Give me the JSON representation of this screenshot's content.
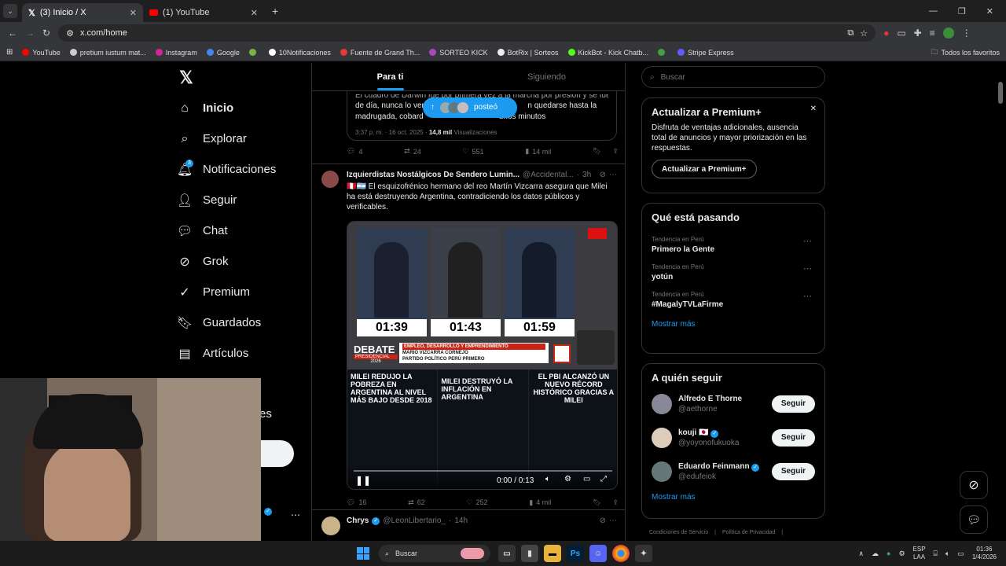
{
  "browser": {
    "tabs": [
      {
        "label": "(3) Inicio / X"
      },
      {
        "label": "(1) YouTube"
      }
    ],
    "url": "x.com/home",
    "bookmarks": [
      {
        "label": "YouTube",
        "color": "#ff0000"
      },
      {
        "label": "pretium iustum mat...",
        "color": "#cccccc"
      },
      {
        "label": "Instagram",
        "color": "#d6249f"
      },
      {
        "label": "Google",
        "color": "#4285f4"
      },
      {
        "label": "",
        "color": "#7cb342"
      },
      {
        "label": "10Notificaciones",
        "color": "#ffffff"
      },
      {
        "label": "Fuente de Grand Th...",
        "color": "#e53935"
      },
      {
        "label": "SORTEO KICK",
        "color": "#ab47bc"
      },
      {
        "label": "BotRix | Sorteos",
        "color": "#eeeeee"
      },
      {
        "label": "KickBot - Kick Chatb...",
        "color": "#53fc18"
      },
      {
        "label": "",
        "color": "#43a047"
      },
      {
        "label": "Stripe Express",
        "color": "#635bff"
      }
    ],
    "all_bookmarks": "Todos los favoritos"
  },
  "nav": {
    "items": [
      {
        "label": "Inicio",
        "icon": "home-icon"
      },
      {
        "label": "Explorar",
        "icon": "search-icon"
      },
      {
        "label": "Notificaciones",
        "icon": "bell-icon",
        "badge": "3"
      },
      {
        "label": "Seguir",
        "icon": "add-person-icon"
      },
      {
        "label": "Chat",
        "icon": "chat-icon"
      },
      {
        "label": "Grok",
        "icon": "grok-icon"
      },
      {
        "label": "Premium",
        "icon": "premium-icon"
      },
      {
        "label": "Guardados",
        "icon": "bookmark-icon"
      },
      {
        "label": "Artículos",
        "icon": "article-icon"
      }
    ],
    "partial_label": "es"
  },
  "feed": {
    "tabs": {
      "for_you": "Para ti",
      "following": "Siguiendo"
    },
    "quoted": {
      "text_line1": "El cuadro de Darwin fue por primera vez a la marcha por presión y se fue",
      "text_line2": "de día, nunca lo vere",
      "text_line2b": "n quedarse hasta la",
      "text_line3": "madrugada, cobard",
      "text_line3b": "unos minutos",
      "time": "3:37 p. m. · 16 oct. 2025 ·",
      "views_count": "14,8 mil",
      "views_label": "Visualizaciones"
    },
    "posted_pill": "posteó",
    "first_actions": {
      "replies": "4",
      "reposts": "24",
      "likes": "551",
      "views": "14 mil"
    },
    "post": {
      "author": "Izquierdistas Nostálgicos De Sendero Lumin...",
      "handle": "@Accidental...",
      "time": "3h",
      "text_line1": "🇵🇪🇦🇷 El esquizofrénico hermano del reo Martín Vizcarra asegura que Milei",
      "text_line2": "ha está destruyendo Argentina, contradiciendo los datos públicos y",
      "text_line3": "verificables.",
      "video": {
        "timers": [
          "01:39",
          "01:43",
          "01:59"
        ],
        "debate_label": "DEBATE",
        "debate_sub": "PRESIDENCIAL",
        "debate_year": "2026",
        "banner_top": "EMPLEO, DESARROLLO Y EMPRENDIMIENTO",
        "banner_name": "MARIO VIZCARRA CORNEJO",
        "banner_party": "PARTIDO POLÍTICO PERÚ PRIMERO",
        "panel1": "MILEI REDUJO LA POBREZA EN ARGENTINA AL NIVEL MÁS BAJO DESDE 2018",
        "panel2": "MILEI DESTRUYÓ LA INFLACIÓN EN ARGENTINA",
        "panel3": "EL PBI ALCANZÓ UN NUEVO RÉCORD HISTÓRICO GRACIAS A MILEI",
        "time_display": "0:00 / 0:13",
        "progress": 0.0
      },
      "actions": {
        "replies": "16",
        "reposts": "62",
        "likes": "252",
        "views": "4 mil"
      }
    },
    "next_post": {
      "author": "Chrys",
      "handle": "@LeonLibertario_",
      "time": "14h"
    }
  },
  "right": {
    "search_placeholder": "Buscar",
    "premium": {
      "title": "Actualizar a Premium+",
      "body": "Disfruta de ventajas adicionales, ausencia total de anuncios y mayor priorización en las respuestas.",
      "button": "Actualizar a Premium+"
    },
    "trends": {
      "title": "Qué está pasando",
      "items": [
        {
          "context": "Tendencia en Perú",
          "name": "Primero la Gente"
        },
        {
          "context": "Tendencia en Perú",
          "name": "yotún"
        },
        {
          "context": "Tendencia en Perú",
          "name": "#MagalyTVLaFirme"
        }
      ],
      "show_more": "Mostrar más"
    },
    "who_to_follow": {
      "title": "A quién seguir",
      "items": [
        {
          "name": "Alfredo E Thorne",
          "handle": "@aethorne",
          "button": "Seguir"
        },
        {
          "name": "kouji 🇯🇵",
          "handle": "@yoyonofukuoka",
          "button": "Seguir"
        },
        {
          "name": "Eduardo Feinmann",
          "handle": "@edufeiok",
          "button": "Seguir"
        }
      ],
      "show_more": "Mostrar más"
    },
    "footer": {
      "terms": "Condiciones de Servicio",
      "privacy": "Política de Privacidad"
    }
  },
  "taskbar": {
    "search": "Buscar",
    "lang_top": "ESP",
    "lang_bottom": "LAA",
    "time": "01:36",
    "date": "1/4/2026"
  }
}
